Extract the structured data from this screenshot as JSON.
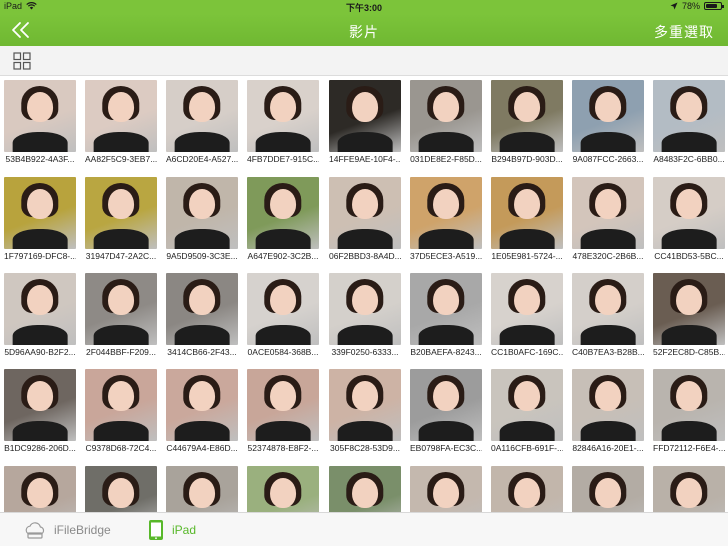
{
  "status": {
    "device": "iPad",
    "time": "下午3:00",
    "battery": "78%",
    "battery_level": 0.78
  },
  "nav": {
    "title": "影片",
    "multi_select": "多重選取"
  },
  "colors": {
    "accent": "#7cc43a",
    "tab_active": "#58b82a",
    "tab_inactive": "#8a8a8a"
  },
  "tabs": [
    {
      "label": "iFileBridge",
      "icon": "cloud-drive-icon",
      "active": false
    },
    {
      "label": "iPad",
      "icon": "tablet-icon",
      "active": true
    }
  ],
  "files": [
    {
      "name": "53B4B922-4A3F...",
      "tone": "#d9c9c0"
    },
    {
      "name": "AA82F5C9-3EB7...",
      "tone": "#dccbc2"
    },
    {
      "name": "A6CD20E4-A527...",
      "tone": "#d6cec8"
    },
    {
      "name": "4FB7DDE7-915C...",
      "tone": "#d9d1cb"
    },
    {
      "name": "14FFE9AE-10F4-...",
      "tone": "#2d2a26"
    },
    {
      "name": "031DE8E2-F85D...",
      "tone": "#9a9690"
    },
    {
      "name": "B294B97D-903D...",
      "tone": "#7f7a62"
    },
    {
      "name": "9A087FCC-2663...",
      "tone": "#8ea0b0"
    },
    {
      "name": "A8483F2C-6BB0...",
      "tone": "#b3bcc4"
    },
    {
      "name": "1F797169-DFC8-...",
      "tone": "#b8a33d"
    },
    {
      "name": "31947D47-2A2C...",
      "tone": "#b9a641"
    },
    {
      "name": "9A5D9509-3C3E...",
      "tone": "#c0b6aa"
    },
    {
      "name": "A647E902-3C2B...",
      "tone": "#7f9a5a"
    },
    {
      "name": "06F2BBD3-8A4D...",
      "tone": "#cdbfb3"
    },
    {
      "name": "37D5ECE3-A519...",
      "tone": "#cfa36a"
    },
    {
      "name": "1E05E981-5724-...",
      "tone": "#c49a5a"
    },
    {
      "name": "478E320C-2B6B...",
      "tone": "#d3c5bb"
    },
    {
      "name": "CC41BD53-5BC...",
      "tone": "#d5cdc6"
    },
    {
      "name": "5D96AA90-B2F2...",
      "tone": "#cfc7c0"
    },
    {
      "name": "2F044BBF-F209...",
      "tone": "#8e8a86"
    },
    {
      "name": "3414CB66-2F43...",
      "tone": "#8b8783"
    },
    {
      "name": "0ACE0584-368B...",
      "tone": "#d6d2ce"
    },
    {
      "name": "339F0250-6333...",
      "tone": "#d4d0cb"
    },
    {
      "name": "B20BAEFA-8243...",
      "tone": "#a8a8a8"
    },
    {
      "name": "CC1B0AFC-169C...",
      "tone": "#d7d2cd"
    },
    {
      "name": "C40B7EA3-B28B...",
      "tone": "#d4cfca"
    },
    {
      "name": "52F2EC8D-C85B...",
      "tone": "#6a5d52"
    },
    {
      "name": "B1DC9286-206D...",
      "tone": "#6e6660"
    },
    {
      "name": "C9378D68-72C4...",
      "tone": "#c9a69a"
    },
    {
      "name": "C44679A4-E86D...",
      "tone": "#caa89c"
    },
    {
      "name": "52374878-E8F2-...",
      "tone": "#c8a699"
    },
    {
      "name": "305F8C28-53D9...",
      "tone": "#cdb3a5"
    },
    {
      "name": "EB0798FA-EC3C...",
      "tone": "#9c9c9c"
    },
    {
      "name": "0A116CFB-691F-...",
      "tone": "#c9c4bd"
    },
    {
      "name": "82846A16-20E1-...",
      "tone": "#c7bfb7"
    },
    {
      "name": "FFD72112-F6E4-...",
      "tone": "#b9b4ae"
    },
    {
      "name": "",
      "tone": "#b6a79d"
    },
    {
      "name": "",
      "tone": "#6f6e68"
    },
    {
      "name": "",
      "tone": "#a9a39b"
    },
    {
      "name": "",
      "tone": "#9ab07e"
    },
    {
      "name": "",
      "tone": "#7a8f6a"
    },
    {
      "name": "",
      "tone": "#c4b8ae"
    },
    {
      "name": "",
      "tone": "#c2b6ab"
    },
    {
      "name": "",
      "tone": "#b3aca4"
    },
    {
      "name": "",
      "tone": "#b9b1a8"
    }
  ]
}
